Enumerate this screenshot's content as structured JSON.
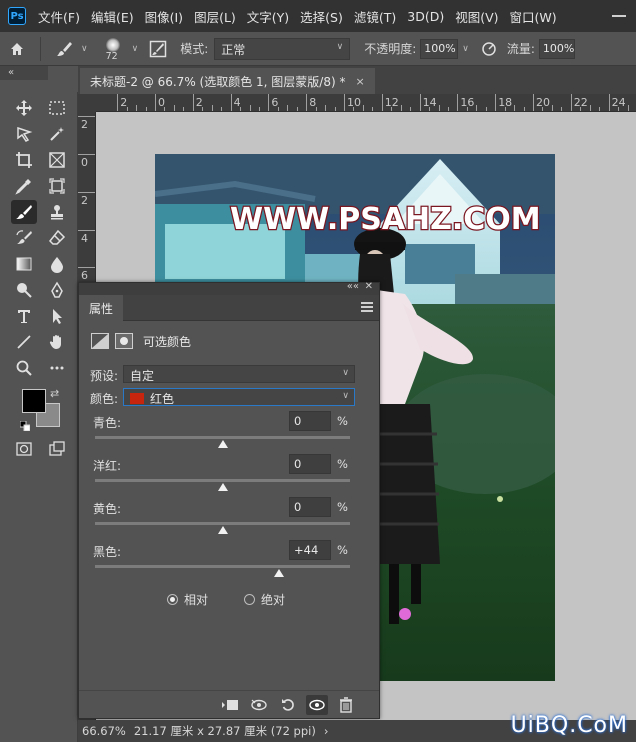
{
  "menubar": {
    "logo": "Ps",
    "items": [
      "文件(F)",
      "编辑(E)",
      "图像(I)",
      "图层(L)",
      "文字(Y)",
      "选择(S)",
      "滤镜(T)",
      "3D(D)",
      "视图(V)",
      "窗口(W)"
    ]
  },
  "options": {
    "brush_size": "72",
    "mode_label": "模式:",
    "mode_value": "正常",
    "opacity_label": "不透明度:",
    "opacity_value": "100%",
    "flow_label": "流量:",
    "flow_value": "100%"
  },
  "collapse_left": "«",
  "document": {
    "tab_title": "未标题-2 @ 66.7% (选取颜色 1, 图层蒙版/8) *",
    "close": "×"
  },
  "ruler": {
    "top_labels": [
      "2",
      "0",
      "2",
      "4",
      "6",
      "8",
      "10",
      "12",
      "14",
      "16",
      "18",
      "20",
      "22",
      "24"
    ],
    "left_labels": [
      "2",
      "0",
      "2",
      "4",
      "6"
    ]
  },
  "photo": {
    "watermark_text": "WWW.PSAHZ.COM"
  },
  "properties": {
    "collapse": "««",
    "close": "✕",
    "tab": "属性",
    "adjustment_name": "可选颜色",
    "preset_label": "预设:",
    "preset_value": "自定",
    "color_label": "颜色:",
    "color_value": "红色",
    "color_chip": "#c8250e",
    "sliders": [
      {
        "label": "青色:",
        "value": "0",
        "unit": "%",
        "position_pct": 50
      },
      {
        "label": "洋红:",
        "value": "0",
        "unit": "%",
        "position_pct": 50
      },
      {
        "label": "黄色:",
        "value": "0",
        "unit": "%",
        "position_pct": 50
      },
      {
        "label": "黑色:",
        "value": "+44",
        "unit": "%",
        "position_pct": 72
      }
    ],
    "method_relative": "相对",
    "method_absolute": "绝对",
    "method_selected": "相对"
  },
  "status": {
    "zoom": "66.67%",
    "doc_size": "21.17 厘米 x 27.87 厘米 (72 ppi)",
    "arrow": "›"
  },
  "watermark": "UiBQ.CoM"
}
